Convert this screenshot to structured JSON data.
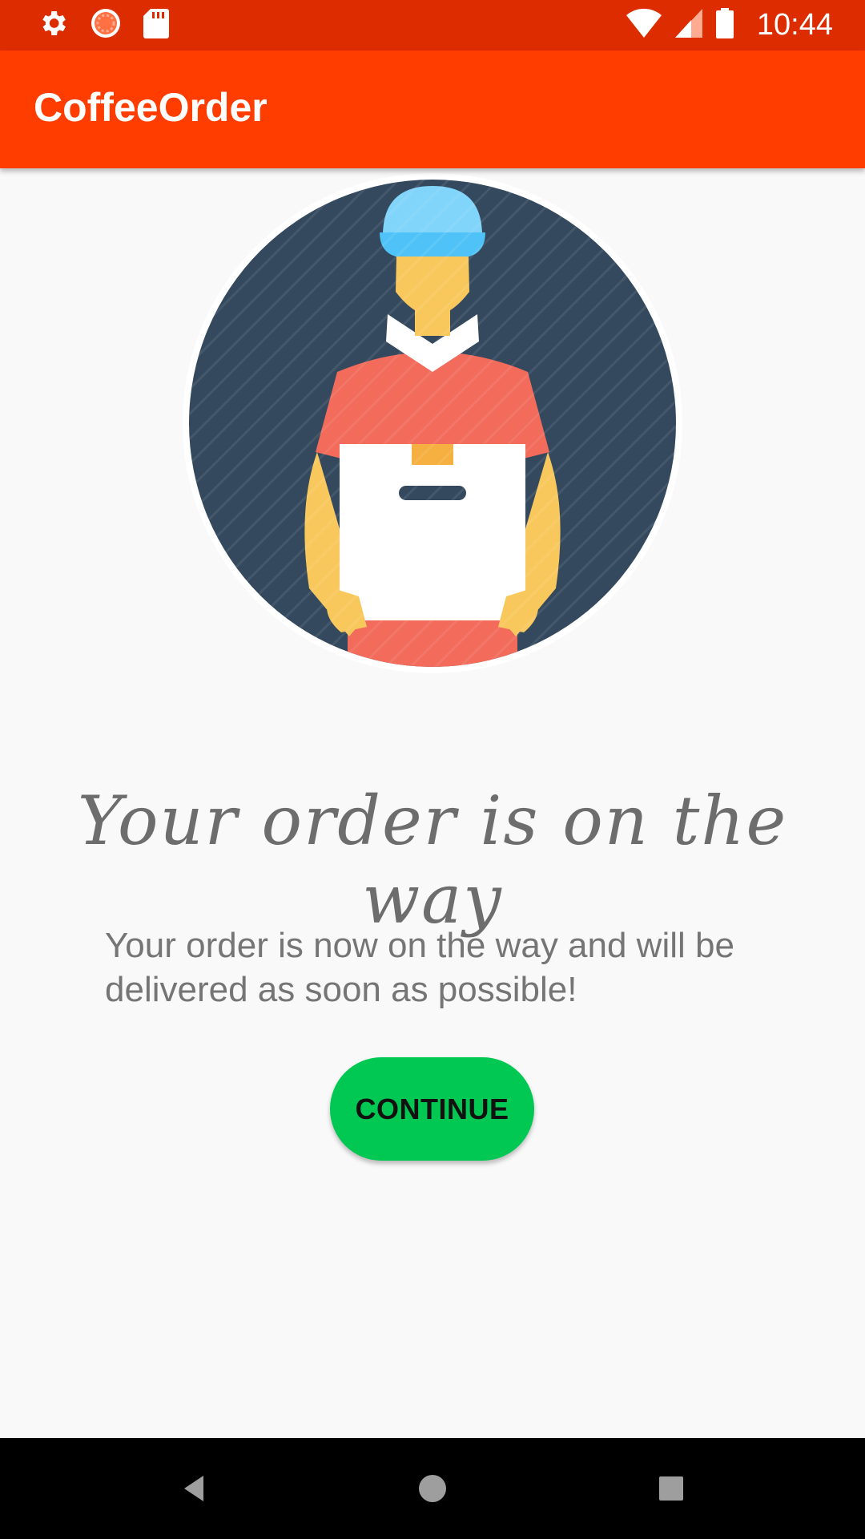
{
  "status_bar": {
    "time": "10:44",
    "left_icons": [
      "gear-icon",
      "sync-icon",
      "sd-card-icon"
    ],
    "right_icons": [
      "wifi-icon",
      "cell-signal-icon",
      "battery-icon"
    ],
    "background": "#dd2c00"
  },
  "app_bar": {
    "title": "CoffeeOrder",
    "background": "#ff3d00"
  },
  "illustration": {
    "icon": "delivery-man-icon"
  },
  "main": {
    "heading": "Your order is on the way",
    "message": "Your order is now on the way and will be delivered as soon as possible!",
    "continue_label": "CONTINUE",
    "button_color": "#00c853"
  },
  "nav_bar": {
    "buttons": [
      "back-icon",
      "home-icon",
      "recents-icon"
    ]
  }
}
